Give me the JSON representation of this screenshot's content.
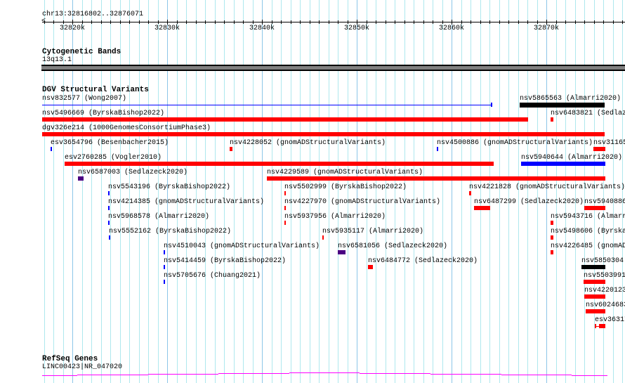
{
  "ruler": {
    "location": "chr13:32816802..32876071",
    "ticks": [
      "32820k",
      "32830k",
      "32840k",
      "32850k",
      "32860k",
      "32870k"
    ]
  },
  "tracks": {
    "cytobands": {
      "title": "Cytogenetic Bands",
      "band_label": "13q13.1",
      "band_color": "#808080"
    },
    "dgv": {
      "title": "DGV Structural Variants",
      "features": [
        {
          "label": "nsv832577 (Wong2007)",
          "color": "#0000ff"
        },
        {
          "label": "nsv5865563 (Almarri2020)",
          "color": "#000000"
        },
        {
          "label": "nsv5496669 (ByrskaBishop2022)",
          "color": "#ff0000"
        },
        {
          "label": "nsv6483821 (Sedlaz",
          "color": "#ff0000"
        },
        {
          "label": "dgv326e214 (1000GenomesConsortiumPhase3)",
          "color": "#ff0000"
        },
        {
          "label": "esv3654796 (Besenbacher2015)",
          "color": "#0000ff"
        },
        {
          "label": "nsv4228052 (gnomADStructuralVariants)",
          "color": "#ff0000"
        },
        {
          "label": "nsv4500886 (gnomADStructuralVariants)",
          "color": "#0000ff"
        },
        {
          "label": "nsv31165",
          "color": "#ff0000"
        },
        {
          "label": "esv2760285 (Vogler2010)",
          "color": "#ff0000"
        },
        {
          "label": "nsv5940644 (Almarri2020)",
          "color": "#0000ff"
        },
        {
          "label": "nsv6587003 (Sedlazeck2020)",
          "color": "#4b0082"
        },
        {
          "label": "nsv4229589 (gnomADStructuralVariants)",
          "color": "#ff0000"
        },
        {
          "label": "nsv5543196 (ByrskaBishop2022)",
          "color": "#0000ff"
        },
        {
          "label": "nsv5502999 (ByrskaBishop2022)",
          "color": "#ff0000"
        },
        {
          "label": "nsv4221828 (gnomADStructuralVariants)",
          "color": "#ff0000"
        },
        {
          "label": "nsv4214385 (gnomADStructuralVariants)",
          "color": "#0000ff"
        },
        {
          "label": "nsv4227970 (gnomADStructuralVariants)",
          "color": "#ff0000"
        },
        {
          "label": "nsv6487299 (Sedlazeck2020)",
          "color": "#ff0000"
        },
        {
          "label": "nsv5940886",
          "color": "#ff0000"
        },
        {
          "label": "nsv5968578 (Almarri2020)",
          "color": "#0000ff"
        },
        {
          "label": "nsv5937956 (Almarri2020)",
          "color": "#ff0000"
        },
        {
          "label": "nsv5943716 (Almarr",
          "color": "#ff0000"
        },
        {
          "label": "nsv5552162 (ByrskaBishop2022)",
          "color": "#0000ff"
        },
        {
          "label": "nsv5935117 (Almarri2020)",
          "color": "#ff0000"
        },
        {
          "label": "nsv5498606 (Byrska",
          "color": "#ff0000"
        },
        {
          "label": "nsv4510043 (gnomADStructuralVariants)",
          "color": "#0000ff"
        },
        {
          "label": "nsv6581056 (Sedlazeck2020)",
          "color": "#4b0082"
        },
        {
          "label": "nsv4226485 (gnomAD",
          "color": "#ff0000"
        },
        {
          "label": "nsv5414459 (ByrskaBishop2022)",
          "color": "#0000ff"
        },
        {
          "label": "nsv6484772 (Sedlazeck2020)",
          "color": "#ff0000"
        },
        {
          "label": "nsv5850304",
          "color": "#000000"
        },
        {
          "label": "nsv5705676 (Chuang2021)",
          "color": "#0000ff"
        },
        {
          "label": "nsv5503991",
          "color": "#ff0000"
        },
        {
          "label": "nsv4220123",
          "color": "#ff0000"
        },
        {
          "label": "nsv6024683",
          "color": "#ff0000"
        },
        {
          "label": "esv36317",
          "color": "#ff0000"
        }
      ]
    },
    "refseq": {
      "title": "RefSeq Genes",
      "gene_label": "LINC00423|NR_047020",
      "color": "#ff00ff"
    }
  }
}
